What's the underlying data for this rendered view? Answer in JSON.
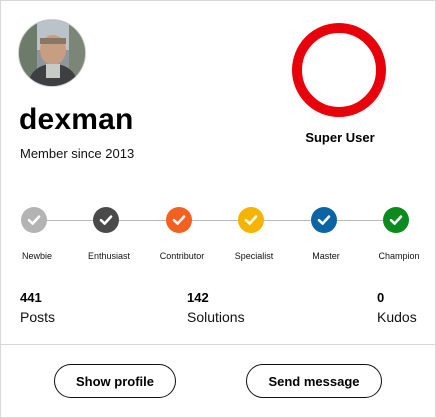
{
  "profile": {
    "username": "dexman",
    "member_since": "Member since 2013",
    "rank": "Super User",
    "rank_color": "#e8000a"
  },
  "levels": [
    {
      "label": "Newbie",
      "color": "#b3b3b3",
      "icon": "check-icon",
      "achieved": true
    },
    {
      "label": "Enthusiast",
      "color": "#4a4a4a",
      "icon": "check-icon",
      "achieved": true
    },
    {
      "label": "Contributor",
      "color": "#f4601f",
      "icon": "check-icon",
      "achieved": true
    },
    {
      "label": "Specialist",
      "color": "#f5b400",
      "icon": "check-icon",
      "achieved": true
    },
    {
      "label": "Master",
      "color": "#0a64a5",
      "icon": "check-icon",
      "achieved": true
    },
    {
      "label": "Champion",
      "color": "#0b8a1e",
      "icon": "check-icon",
      "achieved": true
    }
  ],
  "stats": {
    "posts": {
      "value": "441",
      "label": "Posts"
    },
    "solutions": {
      "value": "142",
      "label": "Solutions"
    },
    "kudos": {
      "value": "0",
      "label": "Kudos"
    }
  },
  "actions": {
    "show_profile": "Show profile",
    "send_message": "Send message"
  }
}
